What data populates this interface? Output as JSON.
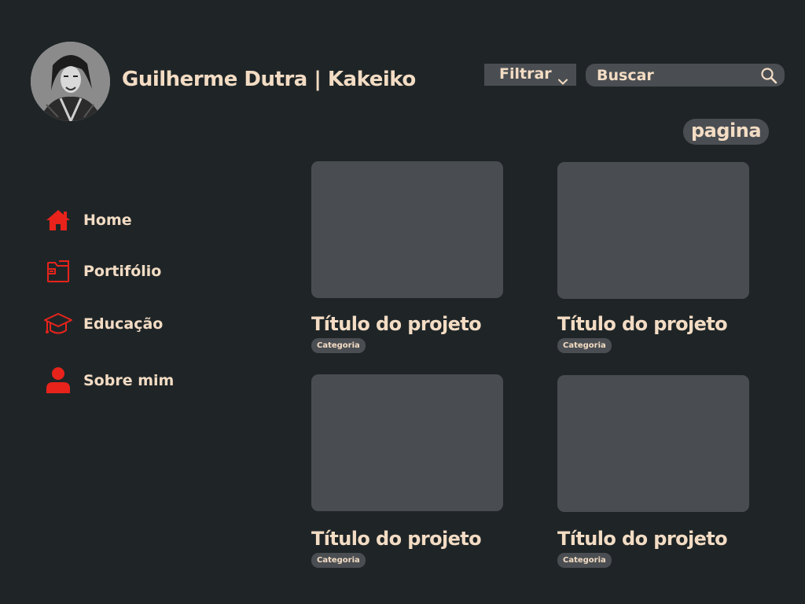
{
  "header": {
    "title": "Guilherme Dutra | Kakeiko",
    "filter_label": "Filtrar",
    "search_placeholder": "Buscar",
    "page_label": "pagina"
  },
  "sidebar": {
    "items": [
      {
        "label": "Home",
        "icon": "home-icon"
      },
      {
        "label": "Portifólio",
        "icon": "folder-icon"
      },
      {
        "label": "Educação",
        "icon": "graduation-cap-icon"
      },
      {
        "label": "Sobre mim",
        "icon": "user-icon"
      }
    ]
  },
  "projects": [
    {
      "title": "Título do projeto",
      "category": "Categoria"
    },
    {
      "title": "Título do projeto",
      "category": "Categoria"
    },
    {
      "title": "Título do projeto",
      "category": "Categoria"
    },
    {
      "title": "Título do projeto",
      "category": "Categoria"
    }
  ],
  "colors": {
    "background": "#1f2527",
    "surface": "#494d51",
    "text": "#f3dcc4",
    "accent": "#e8231b"
  }
}
